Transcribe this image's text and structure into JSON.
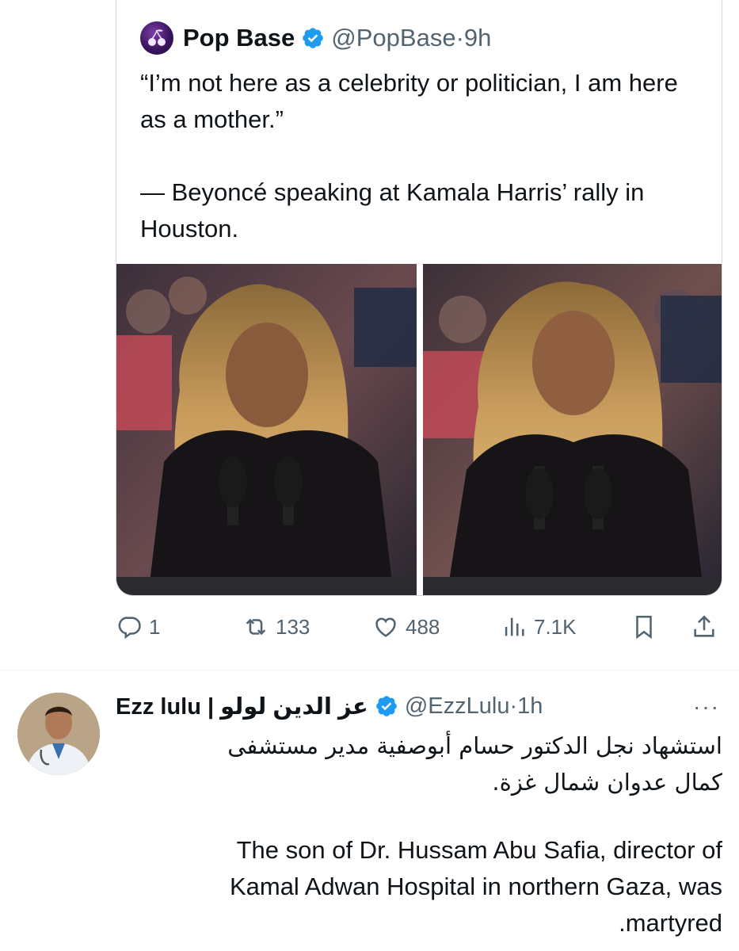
{
  "quoted_tweet": {
    "author_name": "Pop Base",
    "author_handle": "@PopBase",
    "time": "9h",
    "text": "“I’m not here as a celebrity or politician, I am here as a mother.”\n\n— Beyoncé speaking at Kamala Harris’ rally in Houston.",
    "avatar_icon": "cherry-logo-icon",
    "verified_icon": "verified-badge-icon"
  },
  "actions": {
    "replies": "1",
    "reposts": "133",
    "likes": "488",
    "views": "7.1K",
    "icons": [
      "reply-icon",
      "repost-icon",
      "like-icon",
      "views-icon",
      "bookmark-icon",
      "share-icon"
    ]
  },
  "tweet": {
    "author_name": "Ezz lulu | عز الدين لولو",
    "author_handle": "@EzzLulu",
    "time": "1h",
    "more": "···",
    "text_arabic": "استشهاد نجل الدكتور حسام أبوصفية مدير مستشفى\nكمال عدوان شمال غزة.",
    "text_english": "The son of Dr. Hussam Abu Safia, director of\nKamal Adwan Hospital in northern Gaza, was\n.martyred"
  },
  "colors": {
    "text": "#0f1419",
    "secondary": "#536471",
    "verified": "#1d9bf0",
    "border": "#cfd9de"
  }
}
